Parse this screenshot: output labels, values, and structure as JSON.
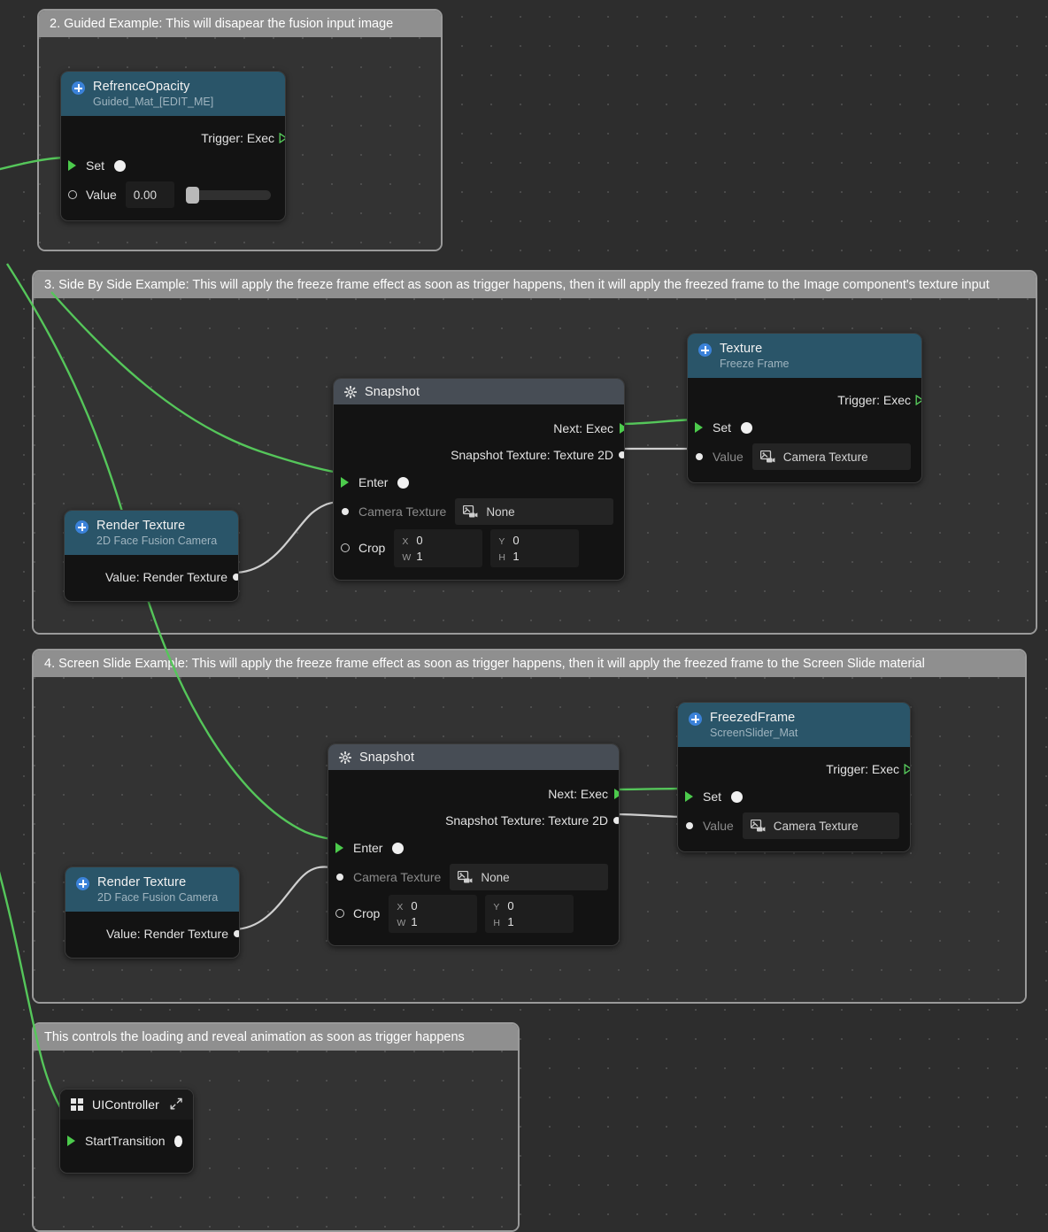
{
  "canvas": {
    "background": "#2d2d2d",
    "grid_dot_color": "#4a4a4a",
    "wire_exec_color": "#55c65a",
    "wire_data_color": "#cfcfcf"
  },
  "groups": [
    {
      "id": "guided",
      "title": "2. Guided Example: This will disapear the fusion input image"
    },
    {
      "id": "sidebyside",
      "title": "3. Side By Side Example: This will apply the freeze frame effect as soon as trigger happens, then it will apply the freezed frame to the Image component's texture input"
    },
    {
      "id": "screenslide",
      "title": "4. Screen Slide Example: This will apply the freeze frame effect as soon as trigger happens, then it will apply the freezed frame to the Screen Slide material"
    },
    {
      "id": "loading",
      "title": "This controls the loading and reveal animation as soon as trigger happens"
    }
  ],
  "nodes": {
    "refrence_opacity": {
      "icon": "plus-circle-icon",
      "title": "RefrenceOpacity",
      "subtitle": "Guided_Mat_[EDIT_ME]",
      "trigger_label": "Trigger: Exec",
      "set_label": "Set",
      "value_label": "Value",
      "value": "0.00",
      "slider_fill_percent": 0
    },
    "snapshot_sbs": {
      "icon": "gear-icon",
      "title": "Snapshot",
      "next_label": "Next: Exec",
      "snapshot_texture_label": "Snapshot Texture: Texture 2D",
      "enter_label": "Enter",
      "camera_texture_label": "Camera Texture",
      "camera_texture_value": "None",
      "crop_label": "Crop",
      "crop": {
        "x_axis": "X",
        "x": "0",
        "y_axis": "Y",
        "y": "0",
        "w_axis": "W",
        "w": "1",
        "h_axis": "H",
        "h": "1"
      }
    },
    "texture_freeze": {
      "icon": "plus-circle-icon",
      "title": "Texture",
      "subtitle": "Freeze Frame",
      "trigger_label": "Trigger: Exec",
      "set_label": "Set",
      "value_label": "Value",
      "value": "Camera Texture"
    },
    "render_texture_sbs": {
      "icon": "plus-circle-icon",
      "title": "Render Texture",
      "subtitle": "2D Face Fusion Camera",
      "output_label": "Value: Render Texture"
    },
    "snapshot_slide": {
      "icon": "gear-icon",
      "title": "Snapshot",
      "next_label": "Next: Exec",
      "snapshot_texture_label": "Snapshot Texture: Texture 2D",
      "enter_label": "Enter",
      "camera_texture_label": "Camera Texture",
      "camera_texture_value": "None",
      "crop_label": "Crop",
      "crop": {
        "x_axis": "X",
        "x": "0",
        "y_axis": "Y",
        "y": "0",
        "w_axis": "W",
        "w": "1",
        "h_axis": "H",
        "h": "1"
      }
    },
    "freezed_frame": {
      "icon": "plus-circle-icon",
      "title": "FreezedFrame",
      "subtitle": "ScreenSlider_Mat",
      "trigger_label": "Trigger: Exec",
      "set_label": "Set",
      "value_label": "Value",
      "value": "Camera Texture"
    },
    "render_texture_slide": {
      "icon": "plus-circle-icon",
      "title": "Render Texture",
      "subtitle": "2D Face Fusion Camera",
      "output_label": "Value: Render Texture"
    },
    "ui_controller": {
      "icon": "grid-icon",
      "title": "UIController",
      "expand_icon": "expand-arrow-icon",
      "start_transition_label": "StartTransition"
    }
  }
}
